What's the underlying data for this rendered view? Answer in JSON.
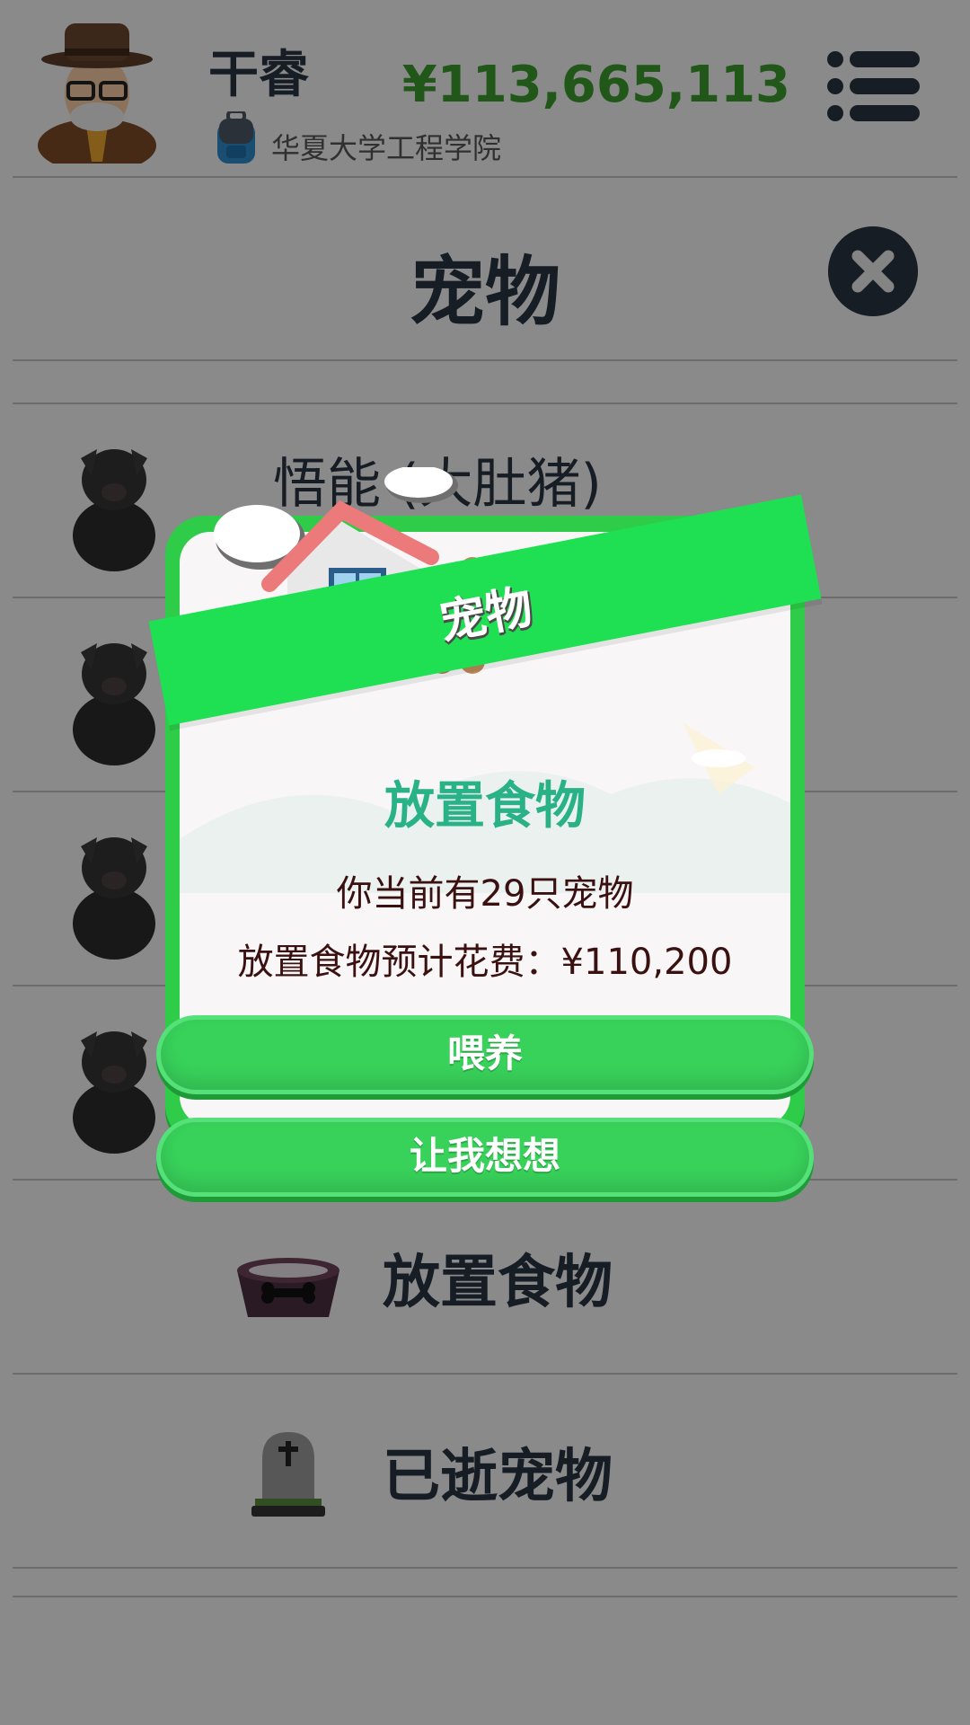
{
  "header": {
    "player_name": "干睿",
    "school": "华夏大学工程学院",
    "money": "¥113,665,113"
  },
  "page": {
    "title": "宠物"
  },
  "pets": [
    {
      "name": "悟能 (大肚猪)"
    },
    {
      "name": ""
    },
    {
      "name": ""
    },
    {
      "name": ""
    }
  ],
  "actions": [
    {
      "label": "放置食物",
      "icon": "food-bowl-icon"
    },
    {
      "label": "已逝宠物",
      "icon": "tombstone-icon"
    }
  ],
  "modal": {
    "banner": "宠物",
    "heading": "放置食物",
    "line1": "你当前有29只宠物",
    "line2": "放置食物预计花费：¥110,200",
    "confirm_label": "喂养",
    "cancel_label": "让我想想"
  },
  "colors": {
    "money": "#3a9b2c",
    "accent_green": "#2ecc48",
    "heading_teal": "#2ab287",
    "dark_text": "#2a3441"
  }
}
